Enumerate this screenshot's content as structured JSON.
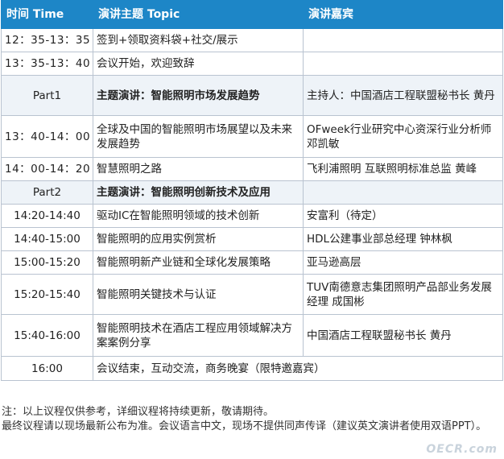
{
  "header": {
    "time": "时间 Time",
    "topic": "演讲主题 Topic",
    "speaker": "演讲嘉宾"
  },
  "rows": [
    {
      "time": "12：35-13：35",
      "topic": "签到+领取资料袋+社交/展示",
      "speaker": ""
    },
    {
      "time": "13：35-13：40",
      "topic": "会议开始，欢迎致辞",
      "speaker": ""
    },
    {
      "time": "Part1",
      "topic": "主题演讲：智能照明市场发展趋势",
      "speaker": "主持人：中国酒店工程联盟秘书长 黄丹"
    },
    {
      "time": "13：40-14：00",
      "topic": "全球及中国的智能照明市场展望以及未来发展趋势",
      "speaker": "OFweek行业研究中心资深行业分析师 邓凯敏"
    },
    {
      "time": "14：00-14：20",
      "topic": "智慧照明之路",
      "speaker": "飞利浦照明 互联照明标准总监 黄峰"
    },
    {
      "time": "Part2",
      "topic": "主题演讲：智能照明创新技术及应用",
      "speaker": ""
    },
    {
      "time": "14:20-14:40",
      "topic": "驱动IC在智能照明领域的技术创新",
      "speaker": "安富利（待定）"
    },
    {
      "time": "14:40-15:00",
      "topic": "智能照明的应用实例赏析",
      "speaker": "HDL公建事业部总经理 钟林枫"
    },
    {
      "time": "15:00-15:20",
      "topic": "智能照明新产业链和全球化发展策略",
      "speaker": "亚马逊高层"
    },
    {
      "time": "15:20-15:40",
      "topic": "智能照明关键技术与认证",
      "speaker": "TUV南德意志集团照明产品部业务发展经理 成国彬"
    },
    {
      "time": "15:40-16:00",
      "topic": "智能照明技术在酒店工程应用领域解决方案案例分享",
      "speaker": "中国酒店工程联盟秘书长 黄丹"
    },
    {
      "time": "16:00",
      "topic": "会议结束，互动交流，商务晚宴（限特邀嘉宾）",
      "speaker": ""
    }
  ],
  "notes": {
    "line1": "注：以上议程仅供参考，详细议程将持续更新，敬请期待。",
    "line2": "最终议程请以现场最新公布为准。会议语言中文，现场不提供同声传译（建议英文演讲者使用双语PPT）。"
  },
  "watermark": "OECR.com"
}
